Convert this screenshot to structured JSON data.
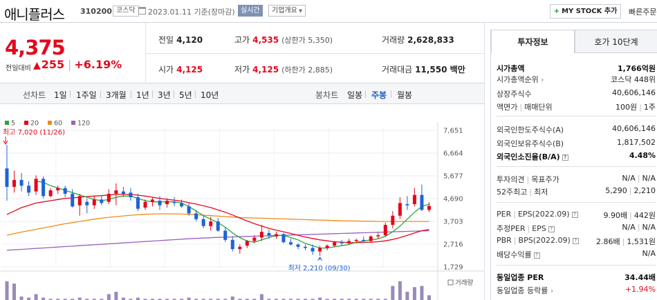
{
  "header": {
    "name": "애니플러스",
    "code": "310200",
    "market": "코스닥",
    "date_text": "2023.01.11  기준(장마감)",
    "realtime": "실시간",
    "company": "기업개요",
    "mystock": "MY STOCK 추가",
    "quick": "빠른주문"
  },
  "price": {
    "current": "4,375",
    "vs_label": "전일대비",
    "change": "255",
    "change_pct": "+6.19%",
    "up_color": "#e3081c"
  },
  "stats": {
    "prev_label": "전일",
    "prev": "4,120",
    "high_label": "고가",
    "high": "4,535",
    "upper_limit": "(상한가 5,350)",
    "vol_label": "거래량",
    "vol": "2,628,833",
    "open_label": "시가",
    "open": "4,125",
    "low_label": "저가",
    "low": "4,125",
    "lower_limit": "(하한가 2,885)",
    "amount_label": "거래대금",
    "amount": "11,550 백만"
  },
  "period_bar": {
    "line_label": "선차트",
    "line_periods": [
      "1일",
      "1주일",
      "3개월",
      "1년",
      "3년",
      "5년",
      "10년"
    ],
    "candle_label": "봉차트",
    "candle_periods": [
      "일봉",
      "주봉",
      "월봉"
    ],
    "active": "주봉"
  },
  "chart_data": {
    "type": "candlestick",
    "interval": "weekly",
    "legend": [
      {
        "name": "5",
        "color": "#27a53a"
      },
      {
        "name": "20",
        "color": "#e3081c"
      },
      {
        "name": "60",
        "color": "#f08a16"
      },
      {
        "name": "120",
        "color": "#9b5fc0"
      }
    ],
    "y_ticks": [
      "7,651",
      "6,664",
      "5,677",
      "4,690",
      "3,703",
      "2,716",
      "1,729"
    ],
    "ylim": [
      1729,
      7651
    ],
    "max_label": "최고 7,020 (11/26)",
    "min_label": "최저 2,210 (09/30)",
    "volume_label": "거래량",
    "up_color": "#e3081c",
    "down_color": "#1e63d6",
    "candles": [
      [
        6000,
        7020,
        4600,
        5200
      ],
      [
        5200,
        5900,
        4950,
        5500
      ],
      [
        5500,
        5800,
        5000,
        5250
      ],
      [
        5250,
        5450,
        4800,
        4950
      ],
      [
        5000,
        5700,
        4850,
        5550
      ],
      [
        5550,
        5650,
        4700,
        4800
      ],
      [
        4800,
        5150,
        4750,
        5050
      ],
      [
        5050,
        5250,
        4900,
        5150
      ],
      [
        5150,
        5250,
        4750,
        4900
      ],
      [
        4900,
        5100,
        4300,
        4350
      ],
      [
        4400,
        4900,
        3950,
        4800
      ],
      [
        4550,
        4700,
        4050,
        4400
      ],
      [
        4400,
        4800,
        4250,
        4650
      ],
      [
        4650,
        4800,
        4400,
        4500
      ],
      [
        4550,
        5100,
        4450,
        4900
      ],
      [
        4900,
        5350,
        4400,
        5050
      ],
      [
        5000,
        5200,
        4750,
        4900
      ],
      [
        4950,
        5150,
        4600,
        4750
      ],
      [
        4750,
        4900,
        4150,
        4250
      ],
      [
        4300,
        4650,
        4200,
        4550
      ],
      [
        4550,
        4750,
        4350,
        4650
      ],
      [
        4600,
        4800,
        4200,
        4400
      ],
      [
        4450,
        4700,
        4300,
        4600
      ],
      [
        4550,
        4750,
        4350,
        4500
      ],
      [
        4500,
        4650,
        4300,
        4350
      ],
      [
        4350,
        4500,
        3950,
        4050
      ],
      [
        4050,
        4200,
        3700,
        3800
      ],
      [
        3800,
        3950,
        3400,
        3500
      ],
      [
        3500,
        3900,
        3300,
        3700
      ],
      [
        3700,
        3850,
        3250,
        3300
      ],
      [
        3300,
        3450,
        2800,
        2900
      ],
      [
        2900,
        3050,
        2400,
        2500
      ],
      [
        2500,
        2700,
        2300,
        2600
      ],
      [
        2650,
        2900,
        2550,
        2850
      ],
      [
        2850,
        3100,
        2750,
        3000
      ],
      [
        3000,
        3550,
        2850,
        3250
      ],
      [
        3200,
        3350,
        2950,
        3100
      ],
      [
        3050,
        3250,
        2950,
        3150
      ],
      [
        3150,
        3200,
        2750,
        2800
      ],
      [
        2800,
        2950,
        2650,
        2700
      ],
      [
        2700,
        2750,
        2500,
        2600
      ],
      [
        2600,
        2700,
        2450,
        2550
      ],
      [
        2550,
        2700,
        2250,
        2400
      ],
      [
        2400,
        2650,
        2210,
        2550
      ],
      [
        2550,
        2700,
        2450,
        2650
      ],
      [
        2650,
        2850,
        2600,
        2800
      ],
      [
        2800,
        2900,
        2650,
        2750
      ],
      [
        2750,
        2950,
        2700,
        2850
      ],
      [
        2850,
        2950,
        2750,
        2900
      ],
      [
        2900,
        3050,
        2800,
        2850
      ],
      [
        2850,
        3100,
        2800,
        3050
      ],
      [
        3050,
        3200,
        2950,
        3100
      ],
      [
        3100,
        3650,
        3050,
        3550
      ],
      [
        3550,
        4150,
        3400,
        3950
      ],
      [
        3950,
        4750,
        3800,
        4500
      ],
      [
        4450,
        4800,
        4200,
        4400
      ],
      [
        4450,
        5150,
        4350,
        4850
      ],
      [
        4850,
        5300,
        4150,
        4200
      ],
      [
        4200,
        4535,
        4100,
        4375
      ]
    ],
    "ma": {
      "5": [
        null,
        null,
        null,
        null,
        5450,
        5400,
        5250,
        5150,
        5050,
        4950,
        4850,
        4750,
        4650,
        4600,
        4650,
        4750,
        4800,
        4800,
        4700,
        4600,
        4550,
        4550,
        4550,
        4550,
        4500,
        4350,
        4150,
        3950,
        3800,
        3650,
        3450,
        3200,
        3000,
        2850,
        2800,
        2900,
        3000,
        3100,
        3100,
        3000,
        2900,
        2750,
        2650,
        2550,
        2550,
        2600,
        2650,
        2700,
        2800,
        2850,
        2900,
        2950,
        3050,
        3250,
        3500,
        3800,
        4100,
        4350,
        4450
      ],
      "20": [
        4000,
        4150,
        4300,
        4400,
        4500,
        4550,
        4600,
        4650,
        4700,
        4720,
        4750,
        4780,
        4800,
        4820,
        4850,
        4870,
        4880,
        4870,
        4840,
        4800,
        4750,
        4700,
        4660,
        4620,
        4580,
        4520,
        4450,
        4380,
        4300,
        4200,
        4100,
        3980,
        3850,
        3720,
        3600,
        3500,
        3400,
        3320,
        3250,
        3180,
        3100,
        3020,
        2960,
        2900,
        2860,
        2820,
        2800,
        2780,
        2780,
        2790,
        2800,
        2820,
        2860,
        2920,
        3000,
        3100,
        3200,
        3300,
        3350
      ],
      "60": [
        3100,
        3170,
        3240,
        3300,
        3360,
        3420,
        3480,
        3540,
        3600,
        3650,
        3700,
        3750,
        3800,
        3840,
        3880,
        3910,
        3940,
        3970,
        3990,
        4010,
        4020,
        4030,
        4030,
        4030,
        4020,
        4010,
        3990,
        3970,
        3950,
        3930,
        3910,
        3890,
        3870,
        3860,
        3850,
        3840,
        3830,
        3820,
        3810,
        3800,
        3790,
        3780,
        3770,
        3760,
        3750,
        3740,
        3730,
        3720,
        3720,
        3710,
        3710,
        3700,
        3700,
        3700,
        3700,
        3700,
        3700,
        3700,
        3700
      ],
      "120": [
        2450,
        2470,
        2490,
        2510,
        2530,
        2550,
        2570,
        2590,
        2610,
        2630,
        2650,
        2670,
        2690,
        2710,
        2730,
        2750,
        2770,
        2790,
        2810,
        2830,
        2850,
        2870,
        2890,
        2910,
        2930,
        2950,
        2965,
        2980,
        2995,
        3010,
        3020,
        3030,
        3040,
        3050,
        3060,
        3070,
        3080,
        3090,
        3100,
        3110,
        3120,
        3130,
        3140,
        3150,
        3160,
        3170,
        3180,
        3190,
        3200,
        3210,
        3220,
        3230,
        3240,
        3250,
        3260,
        3270,
        3280,
        3290,
        3300
      ]
    },
    "volume": [
      0.8,
      0.7,
      0.15,
      0.1,
      0.25,
      0.1,
      0.05,
      0.05,
      0.05,
      0.05,
      0.1,
      0.05,
      0.05,
      0.05,
      0.25,
      0.35,
      0.1,
      0.05,
      0.1,
      0.05,
      0.05,
      0.05,
      0.05,
      0.05,
      0.05,
      0.1,
      0.05,
      0.05,
      0.05,
      0.05,
      0.05,
      0.15,
      0.05,
      0.05,
      0.05,
      0.25,
      0.05,
      0.05,
      0.05,
      0.05,
      0.05,
      0.05,
      0.05,
      0.1,
      0.05,
      0.05,
      0.05,
      0.05,
      0.05,
      0.05,
      0.05,
      0.05,
      0.05,
      0.6,
      0.8,
      0.35,
      0.55,
      0.6,
      0.2
    ]
  },
  "right_panel": {
    "tabs": [
      "투자정보",
      "호가 10단계"
    ],
    "rows": [
      {
        "label": "시가총액",
        "value": "1,766억원",
        "bold": true
      },
      {
        "label": "시가총액순위",
        "value": "코스닥 448위",
        "arrow": true
      },
      {
        "label": "상장주식수",
        "value": "40,606,146"
      },
      {
        "label": "액면가",
        "label2": "매매단위",
        "value": "100원",
        "value2": "1주"
      },
      {
        "label": "외국인한도주식수(A)",
        "value": "40,606,146"
      },
      {
        "label": "외국인보유주식수(B)",
        "value": "1,817,502"
      },
      {
        "label": "외국인소진율(B/A)",
        "value": "4.48%",
        "bold": true,
        "help": true
      },
      {
        "label": "투자의견",
        "label2": "목표주가",
        "value": "N/A",
        "value2": "N/A"
      },
      {
        "label": "52주최고",
        "label2": "최저",
        "value": "5,290",
        "value2": "2,210"
      },
      {
        "label": "PER",
        "label2": "EPS(2022.09)",
        "value": "9.90배",
        "value2": "442원",
        "help": true
      },
      {
        "label": "추정PER",
        "label2": "EPS",
        "value": "N/A",
        "value2": "N/A",
        "help": true
      },
      {
        "label": "PBR",
        "label2": "BPS(2022.09)",
        "value": "2.86배",
        "value2": "1,531원",
        "help": true
      },
      {
        "label": "배당수익률",
        "value": "N/A",
        "help": true
      },
      {
        "label": "동일업종 PER",
        "value": "34.44배",
        "bold": true
      },
      {
        "label": "동일업종 등락률",
        "value": "+1.94%",
        "arrow": true,
        "up": true
      }
    ]
  }
}
